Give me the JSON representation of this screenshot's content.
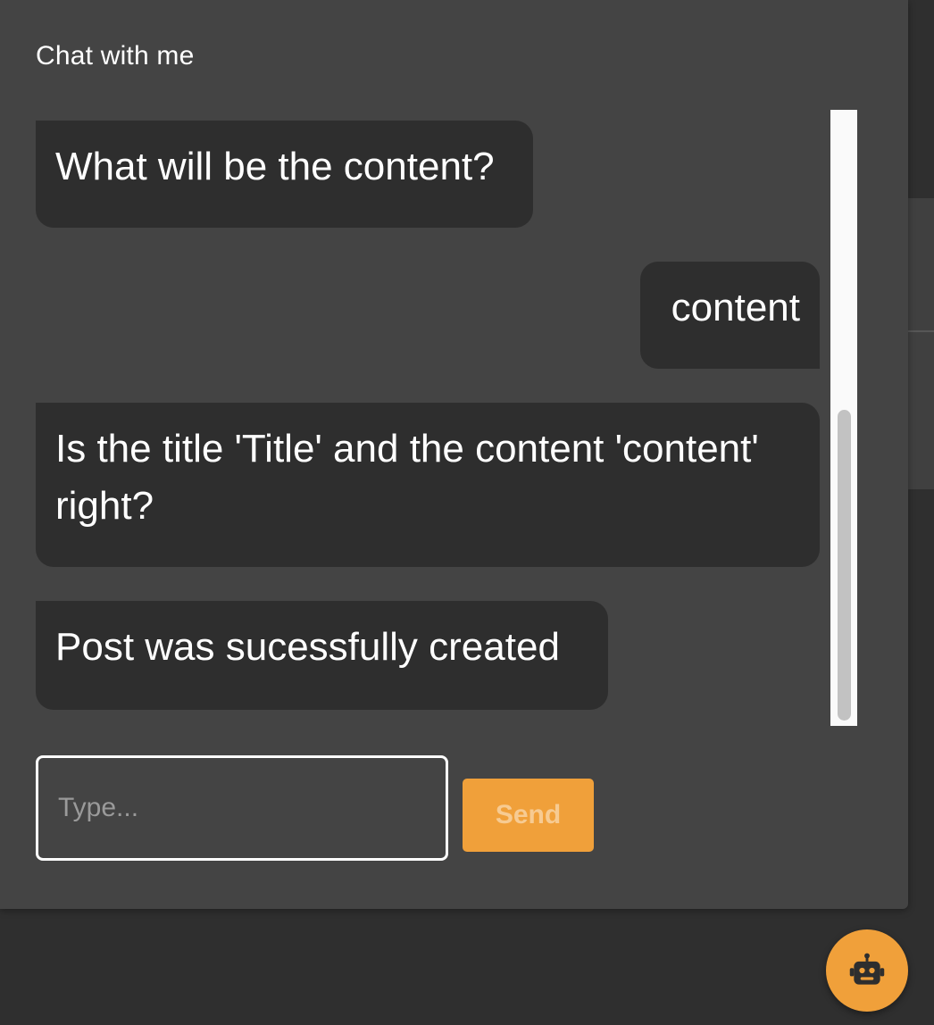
{
  "chat": {
    "title": "Chat with me",
    "messages": [
      {
        "sender": "bot",
        "text": "What will be the content?"
      },
      {
        "sender": "user",
        "text": "content"
      },
      {
        "sender": "bot",
        "text": "Is the title 'Title' and the content 'content' right?"
      },
      {
        "sender": "bot",
        "text": "Post was sucessfully created"
      }
    ],
    "scroll_position": 1.0
  },
  "input": {
    "value": "",
    "placeholder": "Type..."
  },
  "send_button": {
    "label": "Send",
    "disabled": true
  },
  "fab": {
    "icon": "robot-icon"
  },
  "colors": {
    "accent": "#f0a03a",
    "panel_bg": "#444444",
    "bubble_bg": "#2e2e2e",
    "page_bg": "#2f2f2f"
  }
}
